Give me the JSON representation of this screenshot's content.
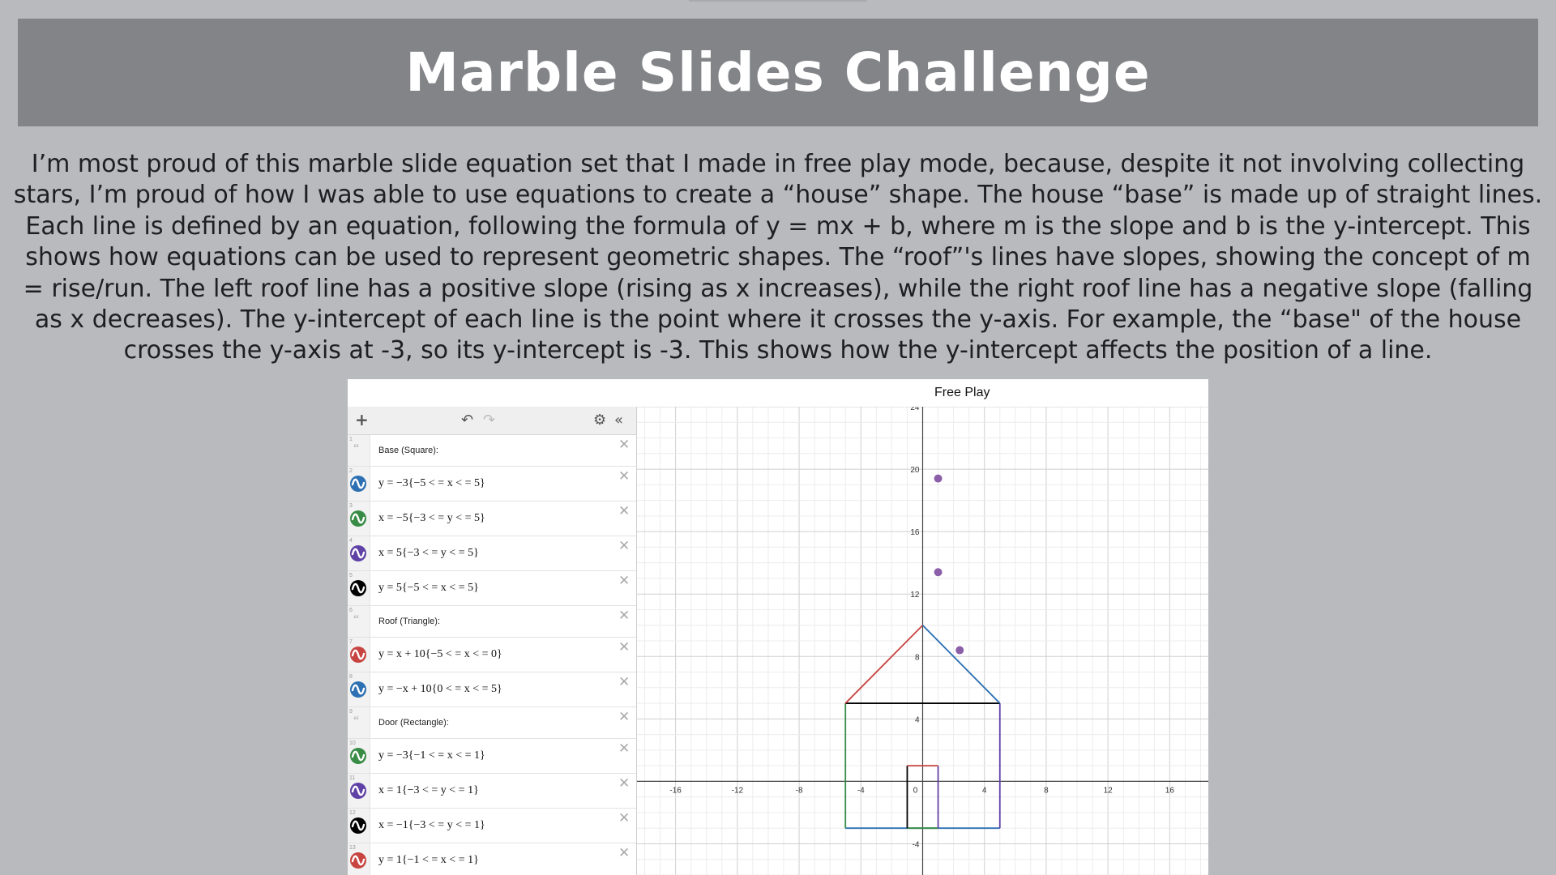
{
  "title": "Marble Slides Challenge",
  "paragraph": "I’m most proud of this marble slide equation set that I made in free play mode, because, despite it not involving collecting stars, I’m proud of how I was able to use equations to create a “house” shape. The house “base” is made up of straight lines. Each line is defined by an equation, following the formula of y = mx + b, where m is the slope and b is the y-intercept. This shows how equations can be used to represent geometric shapes. The “roof”'s lines have slopes, showing the concept of m = rise/run. The left roof line has a positive slope (rising as x increases), while the right roof line has a negative slope (falling as x decreases). The y-intercept of each line is the point where it crosses the y-axis. For example, the “base\" of the house crosses the y-axis at -3, so its y-intercept is -3. This shows how the y-intercept affects the position of a line.",
  "app": {
    "window_title": "Free Play",
    "toolbar": {
      "add_icon": "plus-icon",
      "undo_icon": "undo-icon",
      "redo_icon": "redo-icon",
      "settings_icon": "gear-icon",
      "collapse_icon": "double-chevron-left-icon"
    },
    "rows": [
      {
        "num": "1",
        "kind": "note",
        "text": "Base (Square):"
      },
      {
        "num": "2",
        "kind": "expr",
        "color": "#2d70b3",
        "text": "y = −3{−5 < = x < = 5}"
      },
      {
        "num": "3",
        "kind": "expr",
        "color": "#388c46",
        "text": "x = −5{−3 < = y < = 5}"
      },
      {
        "num": "4",
        "kind": "expr",
        "color": "#6042a6",
        "text": "x = 5{−3 < = y < = 5}"
      },
      {
        "num": "5",
        "kind": "expr",
        "color": "#000000",
        "text": "y = 5{−5 < = x < = 5}"
      },
      {
        "num": "6",
        "kind": "note",
        "text": "Roof (Triangle):"
      },
      {
        "num": "7",
        "kind": "expr",
        "color": "#c74440",
        "text": "y = x + 10{−5 < = x < = 0}"
      },
      {
        "num": "8",
        "kind": "expr",
        "color": "#2d70b3",
        "text": "y = −x + 10{0 < = x < = 5}"
      },
      {
        "num": "9",
        "kind": "note",
        "text": "Door (Rectangle):"
      },
      {
        "num": "10",
        "kind": "expr",
        "color": "#388c46",
        "text": "y = −3{−1 < = x < = 1}"
      },
      {
        "num": "11",
        "kind": "expr",
        "color": "#6042a6",
        "text": "x = 1{−3 < = y < = 1}"
      },
      {
        "num": "12",
        "kind": "expr",
        "color": "#000000",
        "text": "x = −1{−3 < = y < = 1}"
      },
      {
        "num": "13",
        "kind": "expr",
        "color": "#c74440",
        "text": "y = 1{−1 < = x < = 1}"
      }
    ],
    "close_glyph": "✕",
    "graph": {
      "x_range": [
        -18.5,
        18.5
      ],
      "y_range": [
        -6,
        24
      ],
      "x_ticks": [
        "-16",
        "-12",
        "-8",
        "-4",
        "0",
        "4",
        "8",
        "12",
        "16"
      ],
      "y_ticks": [
        "24",
        "20",
        "16",
        "12",
        "8",
        "4",
        "-4"
      ],
      "segments": [
        {
          "color": "#2d70b3",
          "from": [
            -5,
            -3
          ],
          "to": [
            5,
            -3
          ]
        },
        {
          "color": "#388c46",
          "from": [
            -5,
            -3
          ],
          "to": [
            -5,
            5
          ]
        },
        {
          "color": "#6042a6",
          "from": [
            5,
            -3
          ],
          "to": [
            5,
            5
          ]
        },
        {
          "color": "#000000",
          "from": [
            -5,
            5
          ],
          "to": [
            5,
            5
          ]
        },
        {
          "color": "#c74440",
          "from": [
            -5,
            5
          ],
          "to": [
            0,
            10
          ]
        },
        {
          "color": "#2d70b3",
          "from": [
            0,
            10
          ],
          "to": [
            5,
            5
          ]
        },
        {
          "color": "#388c46",
          "from": [
            -1,
            -3
          ],
          "to": [
            1,
            -3
          ]
        },
        {
          "color": "#6042a6",
          "from": [
            1,
            -3
          ],
          "to": [
            1,
            1
          ]
        },
        {
          "color": "#000000",
          "from": [
            -1,
            -3
          ],
          "to": [
            -1,
            1
          ]
        },
        {
          "color": "#c74440",
          "from": [
            -1,
            1
          ],
          "to": [
            1,
            1
          ]
        }
      ],
      "marbles": [
        {
          "x": 1,
          "y": 19.4
        },
        {
          "x": 1,
          "y": 13.4
        },
        {
          "x": 2.4,
          "y": 8.4
        }
      ],
      "marble_color": "#8b5fa8"
    }
  }
}
